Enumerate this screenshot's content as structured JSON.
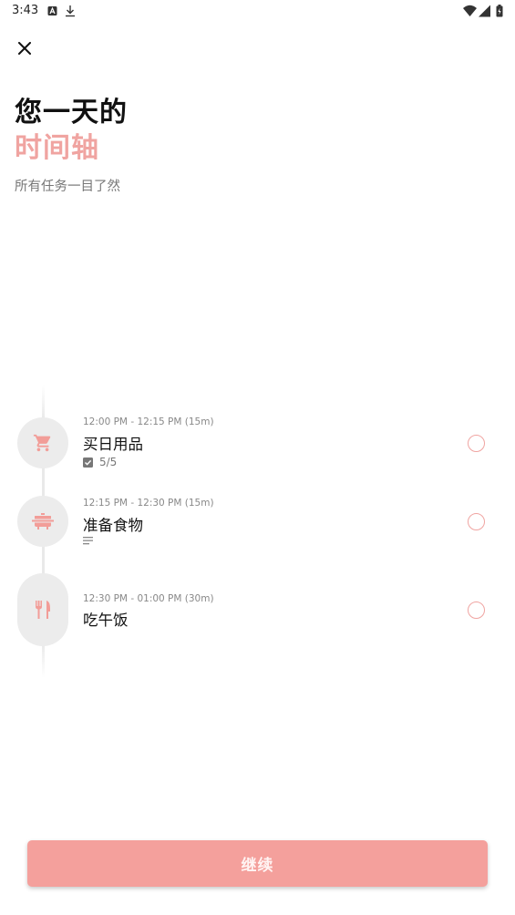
{
  "status_bar": {
    "time": "3:43",
    "icons": [
      "notification-a-icon",
      "download-icon",
      "wifi-icon",
      "signal-icon",
      "battery-icon"
    ]
  },
  "header": {
    "close_icon": "close-icon",
    "title_line1": "您一天的",
    "title_line2": "时间轴",
    "subtitle": "所有任务一目了然"
  },
  "colors": {
    "accent": "#f0a4a1",
    "button": "#f4a09c",
    "icon_bg": "#ececec",
    "icon": "#f29d98"
  },
  "tasks": [
    {
      "time": "12:00 PM - 12:15 PM (15m)",
      "title": "买日用品",
      "icon": "shopping-cart-icon",
      "meta_icon": "checkbox-icon",
      "meta_text": "5/5"
    },
    {
      "time": "12:15 PM - 12:30 PM (15m)",
      "title": "准备食物",
      "icon": "cooking-pot-icon",
      "meta_icon": "notes-icon"
    },
    {
      "time": "12:30 PM - 01:00 PM (30m)",
      "title": "吃午饭",
      "icon": "utensils-icon"
    }
  ],
  "footer": {
    "continue_label": "继续"
  }
}
